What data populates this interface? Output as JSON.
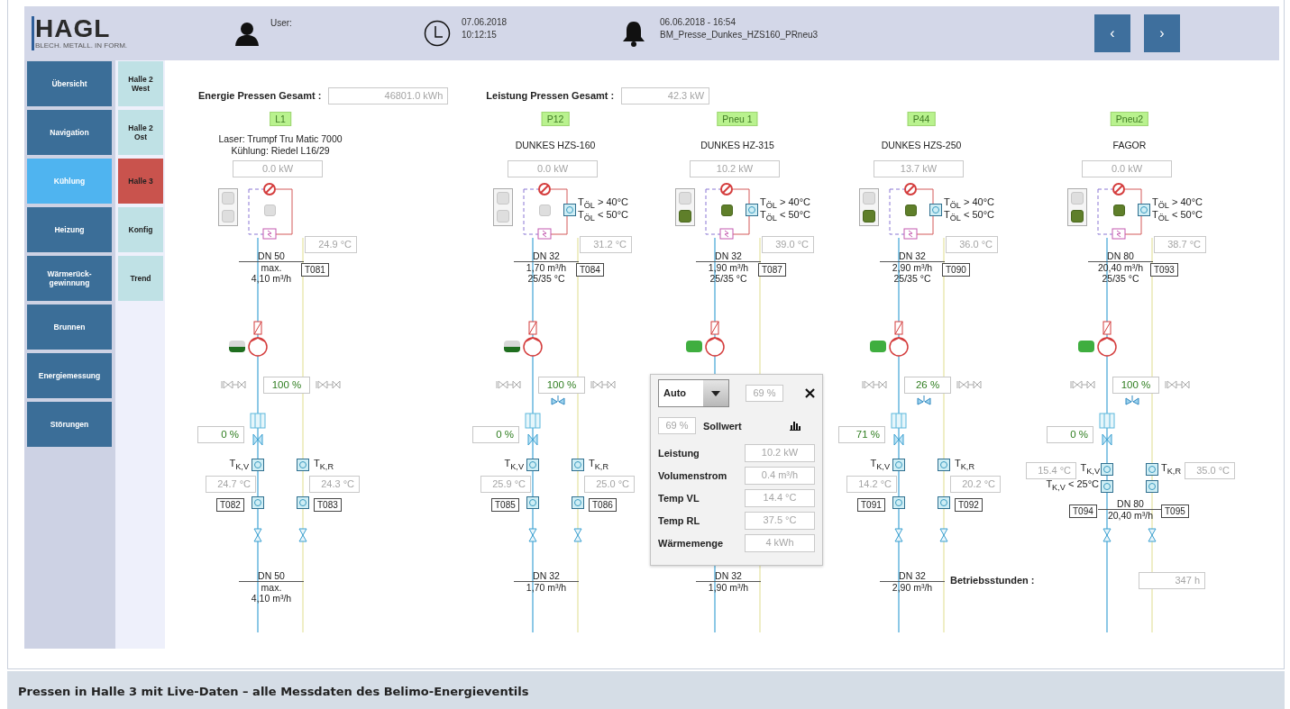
{
  "header": {
    "logo": "HAGL",
    "logo_subtitle": "BLECH. METALL. IN FORM.",
    "user_label": "User:",
    "date": "07.06.2018",
    "time": "10:12:15",
    "alarm_time": "06.06.2018 - 16:54",
    "alarm_text": "BM_Presse_Dunkes_HZS160_PRneu3",
    "nav_buttons": [
      "‹",
      "›"
    ]
  },
  "nav": [
    {
      "label": "Übersicht",
      "selected": false
    },
    {
      "label": "Navigation",
      "selected": false
    },
    {
      "label": "Kühlung",
      "selected": true
    },
    {
      "label": "Heizung",
      "selected": false
    },
    {
      "label": "Wärmerück-gewinnung",
      "selected": false
    },
    {
      "label": "Brunnen",
      "selected": false
    },
    {
      "label": "Energiemessung",
      "selected": false
    },
    {
      "label": "Störungen",
      "selected": false
    }
  ],
  "subnav": [
    {
      "label": "Halle 2 West",
      "selected": false
    },
    {
      "label": "Halle 2 Ost",
      "selected": false
    },
    {
      "label": "Halle 3",
      "selected": true
    },
    {
      "label": "Konfig",
      "selected": false
    },
    {
      "label": "Trend",
      "selected": false
    }
  ],
  "totals": [
    {
      "label": "Energie Pressen Gesamt :",
      "value": "46801.0 kWh"
    },
    {
      "label": "Leistung Pressen Gesamt :",
      "value": "42.3 kW"
    }
  ],
  "presses": [
    {
      "kind": "standard",
      "tag": "L1",
      "title": [
        "Laser: Trumpf Tru Matic 7000",
        "Kühlung: Riedel L16/29"
      ],
      "power": "0.0 kW",
      "lamps": [
        {
          "on": false
        },
        {
          "on": false
        }
      ],
      "controller_on": false,
      "supply_temp": "24.9 °C",
      "dn_top": [
        "DN 50",
        "max.",
        "4,10 m³/h"
      ],
      "tag_top": "T081",
      "pump_on": false,
      "valve": "100 %",
      "actuator": false,
      "flow_valve": "0 %",
      "t_kv_label": "T$_{K,V}$",
      "t_kr_label": "T$_{K,R}$",
      "t_kv": "24.7 °C",
      "t_kr": "24.3 °C",
      "tag_left": "T082",
      "tag_right": "T083",
      "dn_bottom": [
        "DN 50",
        "max.",
        "4,10 m³/h"
      ]
    },
    {
      "kind": "standard",
      "tag": "P12",
      "title": [
        "DUNKES HZS-160"
      ],
      "power": "0.0 kW",
      "lamps": [
        {
          "on": false
        },
        {
          "on": false
        }
      ],
      "controller_on": false,
      "oil_limits": [
        "T$_{ÖL}$ > 40°C",
        "T$_{ÖL}$ < 50°C"
      ],
      "supply_temp": "31.2 °C",
      "dn_top": [
        "DN 32",
        "1,70 m³/h",
        "25/35 °C"
      ],
      "tag_top": "T084",
      "pump_on": false,
      "valve": "100 %",
      "actuator": true,
      "flow_valve": "0 %",
      "t_kv_label": "T$_{K,V}$",
      "t_kr_label": "T$_{K,R}$",
      "t_kv": "25.9 °C",
      "t_kr": "25.0 °C",
      "tag_left": "T085",
      "tag_right": "T086",
      "dn_bottom": [
        "DN 32",
        "1,70 m³/h"
      ]
    },
    {
      "kind": "standard",
      "tag": "Pneu 1",
      "title": [
        "DUNKES HZ-315"
      ],
      "power": "10.2 kW",
      "lamps": [
        {
          "on": false
        },
        {
          "on": true
        }
      ],
      "controller_on": true,
      "oil_limits": [
        "T$_{ÖL}$ > 40°C",
        "T$_{ÖL}$ < 50°C"
      ],
      "supply_temp": "39.0 °C",
      "dn_top": [
        "DN 32",
        "1,90 m³/h",
        "25/35 °C"
      ],
      "tag_top": "T087",
      "pump_on": true,
      "dn_bottom": [
        "DN 32",
        "1,90 m³/h"
      ]
    },
    {
      "kind": "standard",
      "tag": "P44",
      "title": [
        "DUNKES HZS-250"
      ],
      "power": "13.7 kW",
      "lamps": [
        {
          "on": false
        },
        {
          "on": true
        }
      ],
      "controller_on": true,
      "oil_limits": [
        "T$_{ÖL}$ > 40°C",
        "T$_{ÖL}$ < 50°C"
      ],
      "supply_temp": "36.0 °C",
      "dn_top": [
        "DN 32",
        "2,90 m³/h",
        "25/35 °C"
      ],
      "tag_top": "T090",
      "pump_on": true,
      "valve": "26 %",
      "actuator": true,
      "flow_valve": "71 %",
      "t_kv_label": "T$_{K,V}$",
      "t_kr_label": "T$_{K,R}$",
      "t_kv": "14.2 °C",
      "t_kr": "20.2 °C",
      "tag_left": "T091",
      "tag_right": "T092",
      "dn_bottom": [
        "DN 32",
        "2,90 m³/h"
      ]
    },
    {
      "kind": "compact",
      "tag": "Pneu2",
      "title": [
        "FAGOR"
      ],
      "power": "0.0 kW",
      "lamps": [
        {
          "on": false
        },
        {
          "on": true
        }
      ],
      "controller_on": true,
      "oil_limits": [
        "T$_{ÖL}$ > 40°C",
        "T$_{ÖL}$ < 50°C"
      ],
      "supply_temp": "38.7 °C",
      "dn_top": [
        "DN 80",
        "20,40 m³/h",
        "25/35 °C"
      ],
      "tag_top": "T093",
      "pump_on": true,
      "valve": "100 %",
      "actuator": true,
      "flow_valve": "0 %",
      "t_kv_label": "T$_{K,V}$",
      "t_kr_label": "T$_{K,R}$",
      "t_kv": "15.4 °C",
      "t_kr": "35.0 °C",
      "kv_limit": "T$_{K,V}$ < 25°C",
      "tag_left": "T094",
      "tag_right": "T095",
      "dn_middle": [
        "DN 80",
        "20,40 m³/h"
      ],
      "hours": {
        "label": "Betriebsstunden :",
        "value": "347 h"
      }
    }
  ],
  "popup": {
    "mode": "Auto",
    "output": "69 %",
    "setpoint": "69 %",
    "setpoint_label": "Sollwert",
    "rows": [
      {
        "label": "Leistung",
        "value": "10.2 kW"
      },
      {
        "label": "Volumenstrom",
        "value": "0.4 m³/h"
      },
      {
        "label": "Temp VL",
        "value": "14.4 °C"
      },
      {
        "label": "Temp RL",
        "value": "37.5 °C"
      },
      {
        "label": "Wärmemenge",
        "value": "4 kWh"
      }
    ]
  },
  "caption": "Pressen in Halle 3 mit Live-Daten – alle Messdaten des Belimo-Energieventils"
}
